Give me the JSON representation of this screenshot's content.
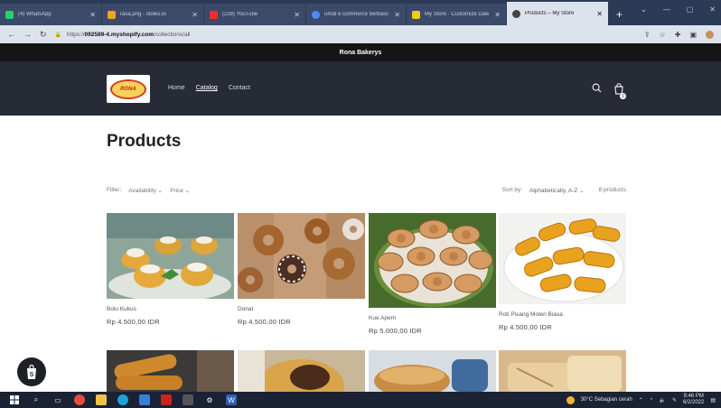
{
  "browser": {
    "tabs": [
      {
        "label": "(4) WhatsApp",
        "color": "#25d366"
      },
      {
        "label": "rasa.png - stoles.io",
        "color": "#f2a41c"
      },
      {
        "label": "(228) YouTube",
        "color": "#ff2a2a"
      },
      {
        "label": "umat e commerce berbasis",
        "color": "#4c8bf5"
      },
      {
        "label": "My Store · Customize Dawn",
        "color": "#f2c81c"
      },
      {
        "label": "Products – My Store",
        "color": "#444444",
        "active": true
      }
    ],
    "new_tab": "+",
    "url_prefix": "https://",
    "url_host": "092589-4.myshopify.com",
    "url_path": "/collections/all"
  },
  "store": {
    "announcement": "Rona Bakerys",
    "logo_text": "RONA",
    "nav": [
      "Home",
      "Catalog",
      "Contact"
    ],
    "search_icon": "search-icon",
    "cart_icon": "cart-icon",
    "cart_count": "1"
  },
  "page": {
    "title": "Products",
    "filter_label": "Filter:",
    "filter_availability": "Availability",
    "filter_price": "Price",
    "sort_label": "Sort by:",
    "sort_value": "Alphabetically, A-Z",
    "product_count": "8 products"
  },
  "products": [
    {
      "title": "Bolu Kukus",
      "price": "Rp 4.500,00 IDR"
    },
    {
      "title": "Donat",
      "price": "Rp 4.500,00 IDR"
    },
    {
      "title": "Kue Apem",
      "price": "Rp 5.000,00 IDR"
    },
    {
      "title": "Roti Pisang Molen Biasa",
      "price": "Rp 4.500,00 IDR"
    }
  ],
  "taskbar": {
    "weather": "30°C  Sebagian cerah",
    "time": "9:46 PM",
    "date": "6/2/2022"
  }
}
